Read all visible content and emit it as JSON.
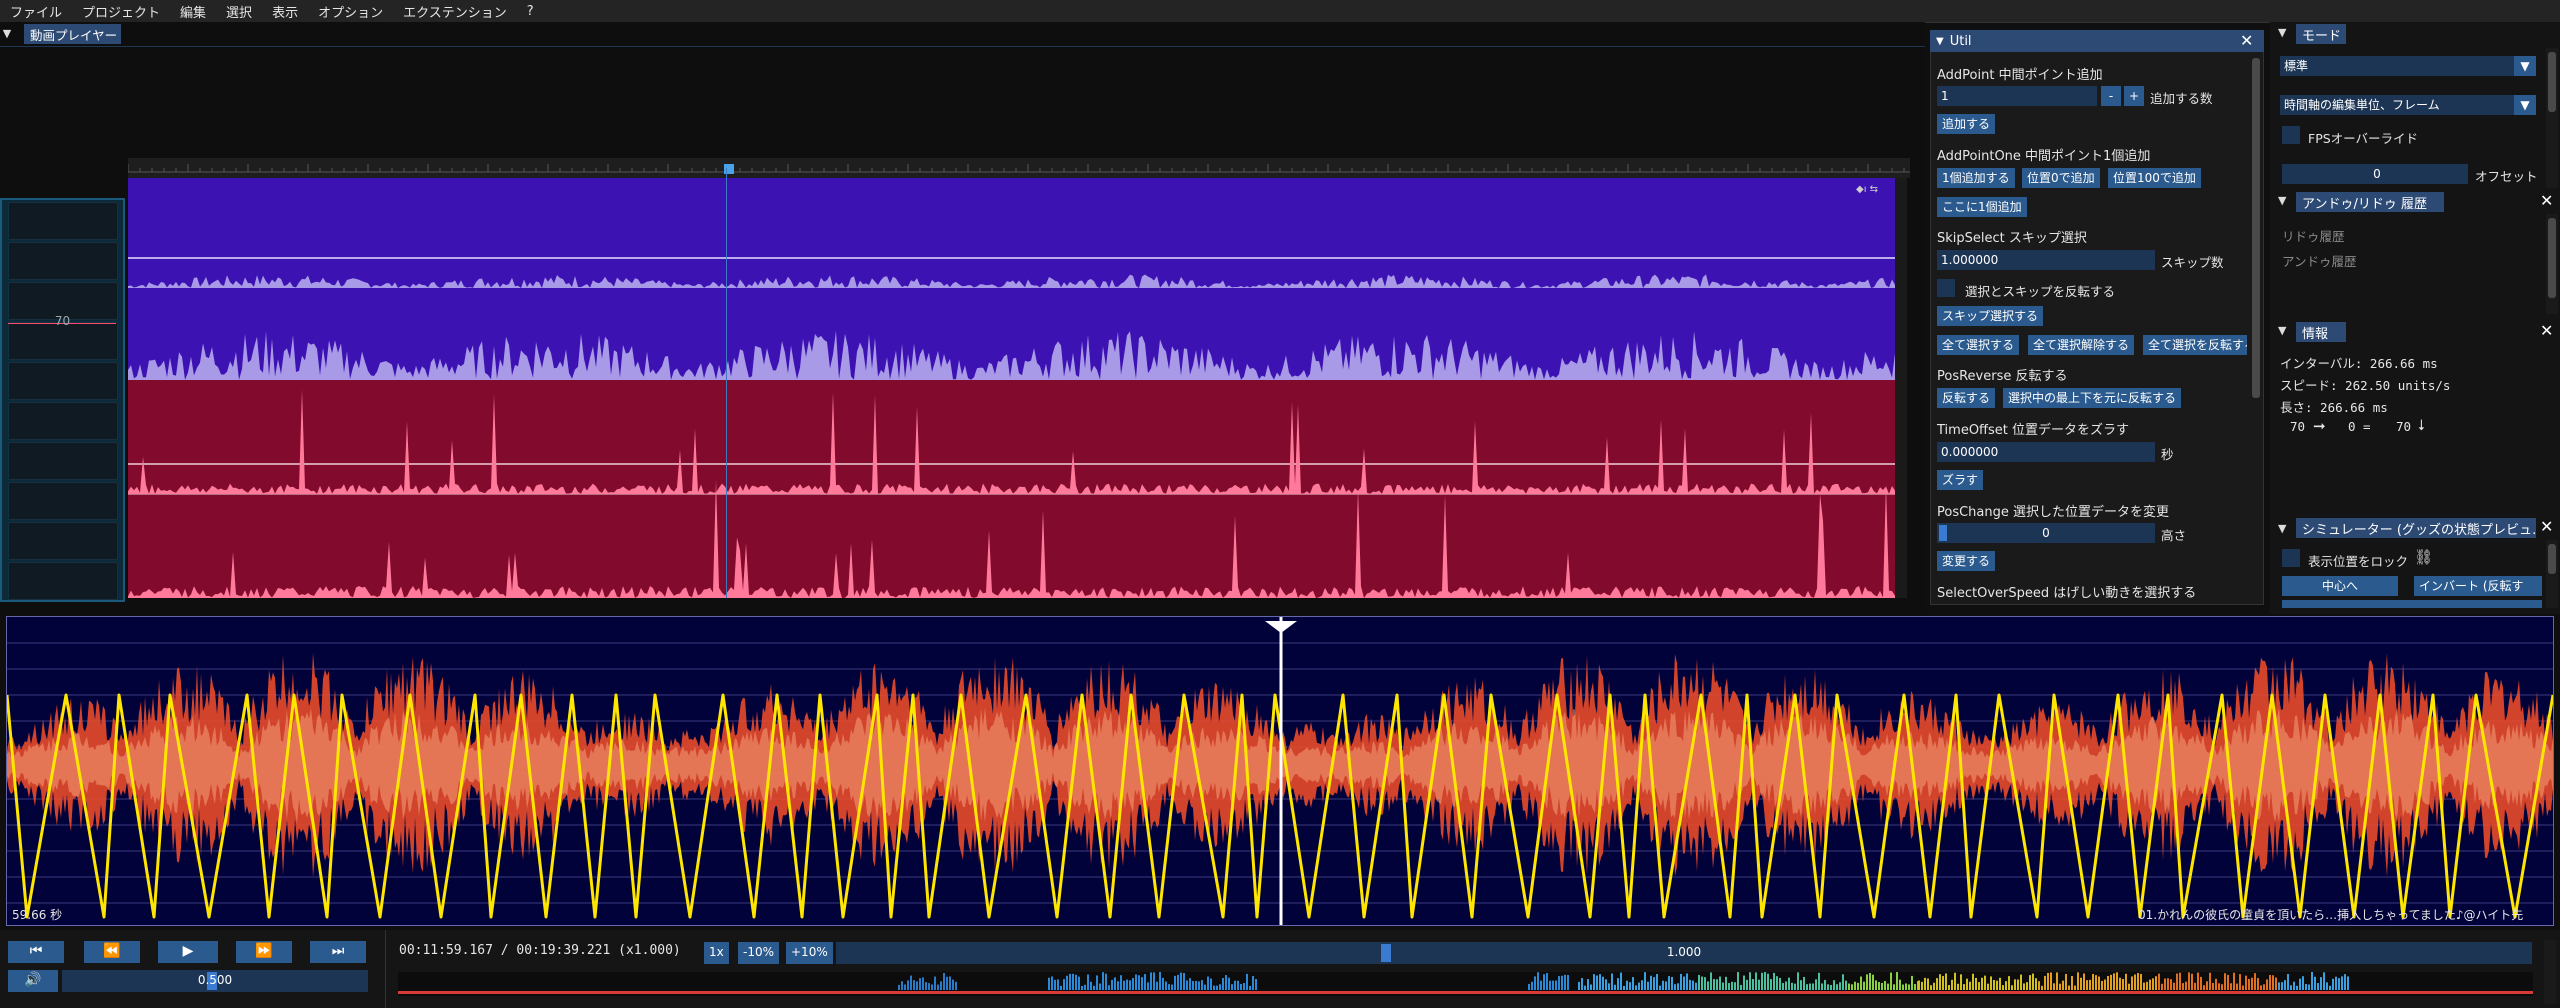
{
  "menubar": [
    "ファイル",
    "プロジェクト",
    "編集",
    "選択",
    "表示",
    "オプション",
    "エクステンション",
    "?"
  ],
  "video_player": {
    "title": "動画プレイヤー"
  },
  "timeline": {
    "left_value": "70"
  },
  "util": {
    "title": "Util",
    "addpoint": {
      "section": "AddPoint 中間ポイント追加",
      "value": "1",
      "minus": "-",
      "plus": "+",
      "count_label": "追加する数",
      "add": "追加する"
    },
    "addpointone": {
      "section": "AddPointOne 中間ポイント1個追加",
      "b1": "1個追加する",
      "b2": "位置0で追加",
      "b3": "位置100で追加",
      "b4": "ここに1個追加"
    },
    "skipselect": {
      "section": "SkipSelect スキップ選択",
      "value": "1.000000",
      "count_label": "スキップ数",
      "invert": "選択とスキップを反転する",
      "skip": "スキップ選択する",
      "all": "全て選択する",
      "none": "全て選択解除する",
      "inv": "全て選択を反転する"
    },
    "posreverse": {
      "section": "PosReverse 反転する",
      "rev": "反転する",
      "rev_sel": "選択中の最上下を元に反転する"
    },
    "timeoffset": {
      "section": "TimeOffset 位置データをズラす",
      "value": "0.000000",
      "unit": "秒",
      "shift": "ズラす"
    },
    "poschange": {
      "section": "PosChange 選択した位置データを変更",
      "value": "0",
      "height_label": "高さ",
      "change": "変更する"
    },
    "selectoverspeed": {
      "section": "SelectOverSpeed はげしい動きを選択する"
    }
  },
  "mode": {
    "title": "モード",
    "mode_value": "標準",
    "unit_value": "時間軸の編集単位、フレーム",
    "fps_override": "FPSオーバーライド",
    "offset_value": "0",
    "offset_label": "オフセット"
  },
  "undo": {
    "title": "アンドゥ/リドゥ 履歴",
    "redo": "リドゥ履歴",
    "undo": "アンドゥ履歴"
  },
  "info": {
    "title": "情報",
    "interval": "インターバル: 266.66 ms",
    "speed": "スピード: 262.50 units/s",
    "length": "長さ: 266.66 ms",
    "from": "70",
    "arrow": "➞",
    "zero": "0 =",
    "to": "70",
    "down": "⭣"
  },
  "simulator": {
    "title": "シミュレーター (グッズの状態プレビュ…",
    "lock": "表示位置をロック",
    "center": "中心へ",
    "invert": "インバート (反転す"
  },
  "waveform": {
    "time_label": "59.66 秒",
    "song_title": "01.かれんの彼氏の童貞を頂いたら…挿入しちゃってました♪@ハイト先"
  },
  "transport": {
    "time": "00:11:59.167 / 00:19:39.221 (x1.000)",
    "speed_1x": "1x",
    "minus10": "-10%",
    "plus10": "+10%",
    "rate": "1.000",
    "volume": "0.500"
  },
  "colors": {
    "accent": "#2b5a8e",
    "title_bar": "#2c4a74",
    "lane_purple": "#3d12b3",
    "lane_red": "#820a2c",
    "yellow": "#ffe600",
    "wave_red": "#e84a2a"
  }
}
